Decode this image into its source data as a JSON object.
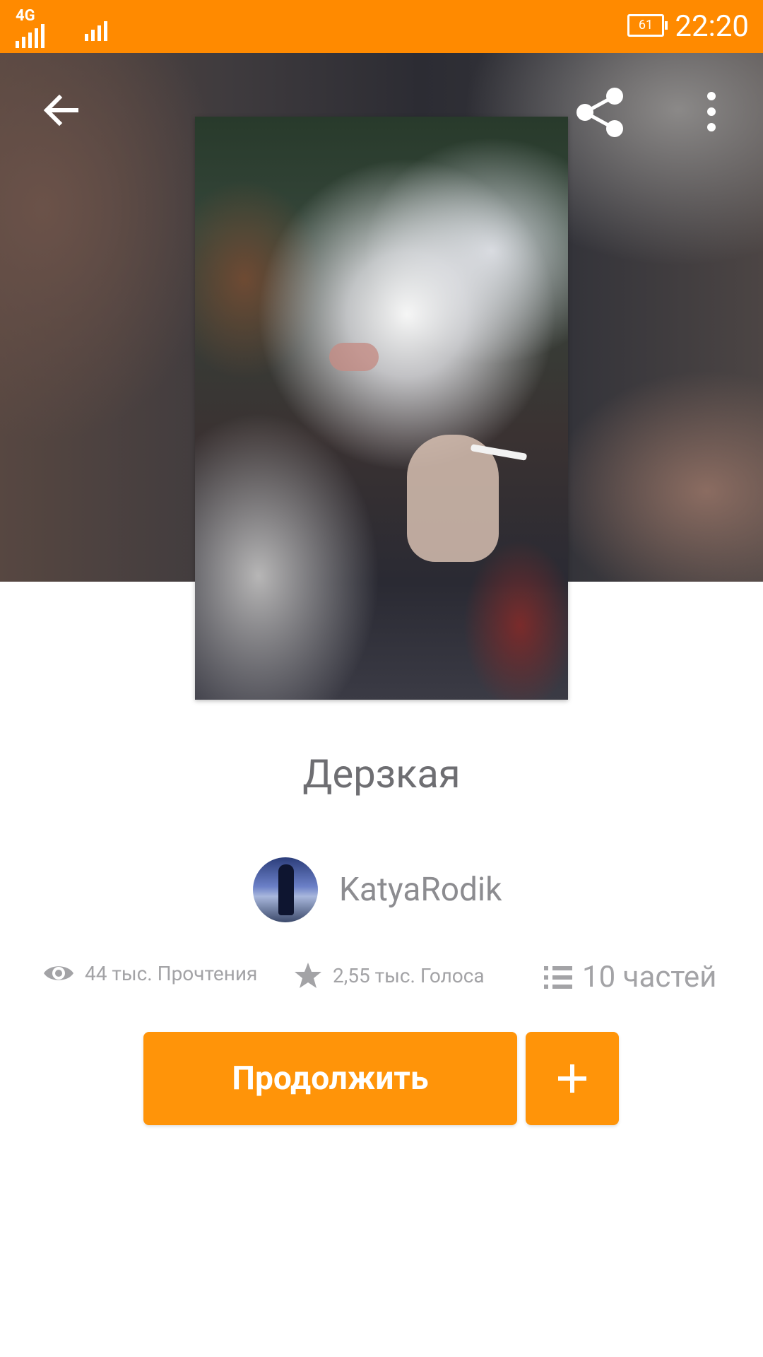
{
  "status_bar": {
    "network": "4G",
    "battery": "61",
    "time": "22:20"
  },
  "header": {
    "icons": [
      "back-arrow-icon",
      "share-icon",
      "more-vert-icon"
    ]
  },
  "story": {
    "title": "Дерзкая",
    "author": "KatyaRodik",
    "stats": {
      "reads": "44 тыс. Прочтения",
      "votes": "2,55 тыс. Голоса",
      "parts": "10 частей"
    }
  },
  "actions": {
    "continue_label": "Продолжить",
    "add_label": "+"
  },
  "colors": {
    "accent": "#ff9409",
    "status_bar": "#ff8a00",
    "title_text": "#6e6e72",
    "meta_text": "#a3a3a6"
  }
}
